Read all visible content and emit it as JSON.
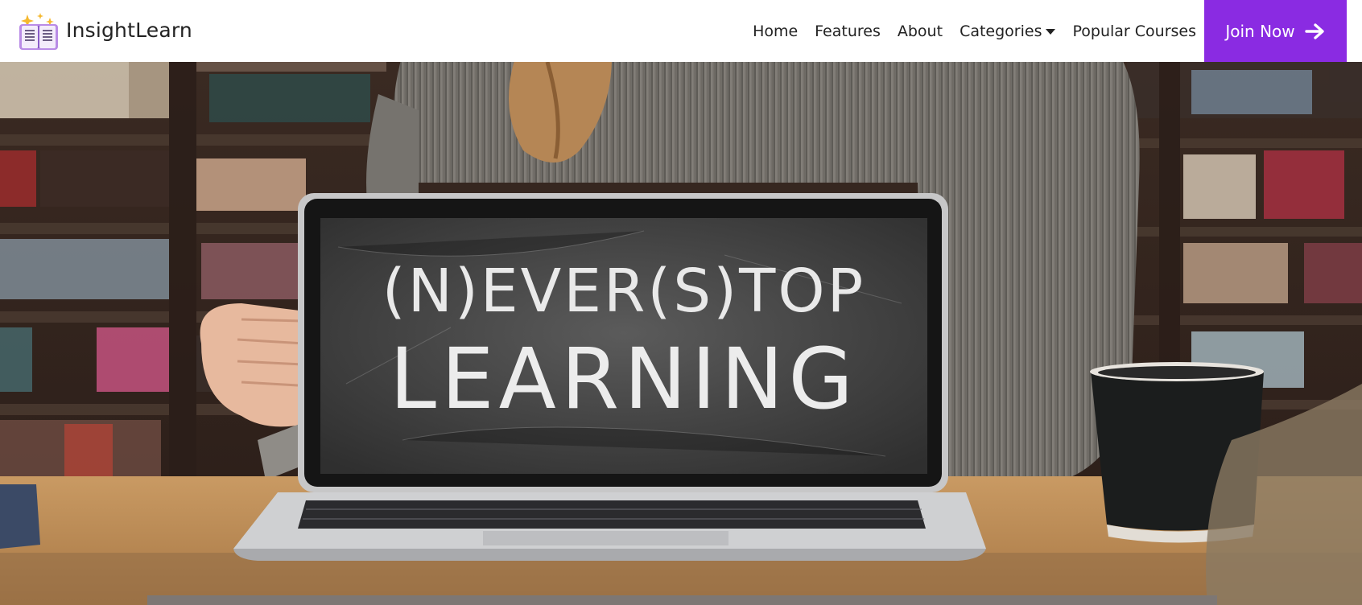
{
  "brand": {
    "name": "InsightLearn",
    "logo_icon": "open-book-sparkles-icon"
  },
  "nav": {
    "items": [
      {
        "label": "Home"
      },
      {
        "label": "Features"
      },
      {
        "label": "About"
      },
      {
        "label": "Categories",
        "has_dropdown": true
      },
      {
        "label": "Popular Courses"
      }
    ],
    "cta": {
      "label": "Join Now",
      "icon": "arrow-right-icon"
    }
  },
  "hero": {
    "image_icon": "laptop-chalkboard-photo",
    "screen_text_line1": "(N)EVER(S)TOP",
    "screen_text_line2": "LEARNING"
  },
  "colors": {
    "accent": "#8a2be2",
    "nav_bg": "#ffffff",
    "text": "#222222"
  }
}
